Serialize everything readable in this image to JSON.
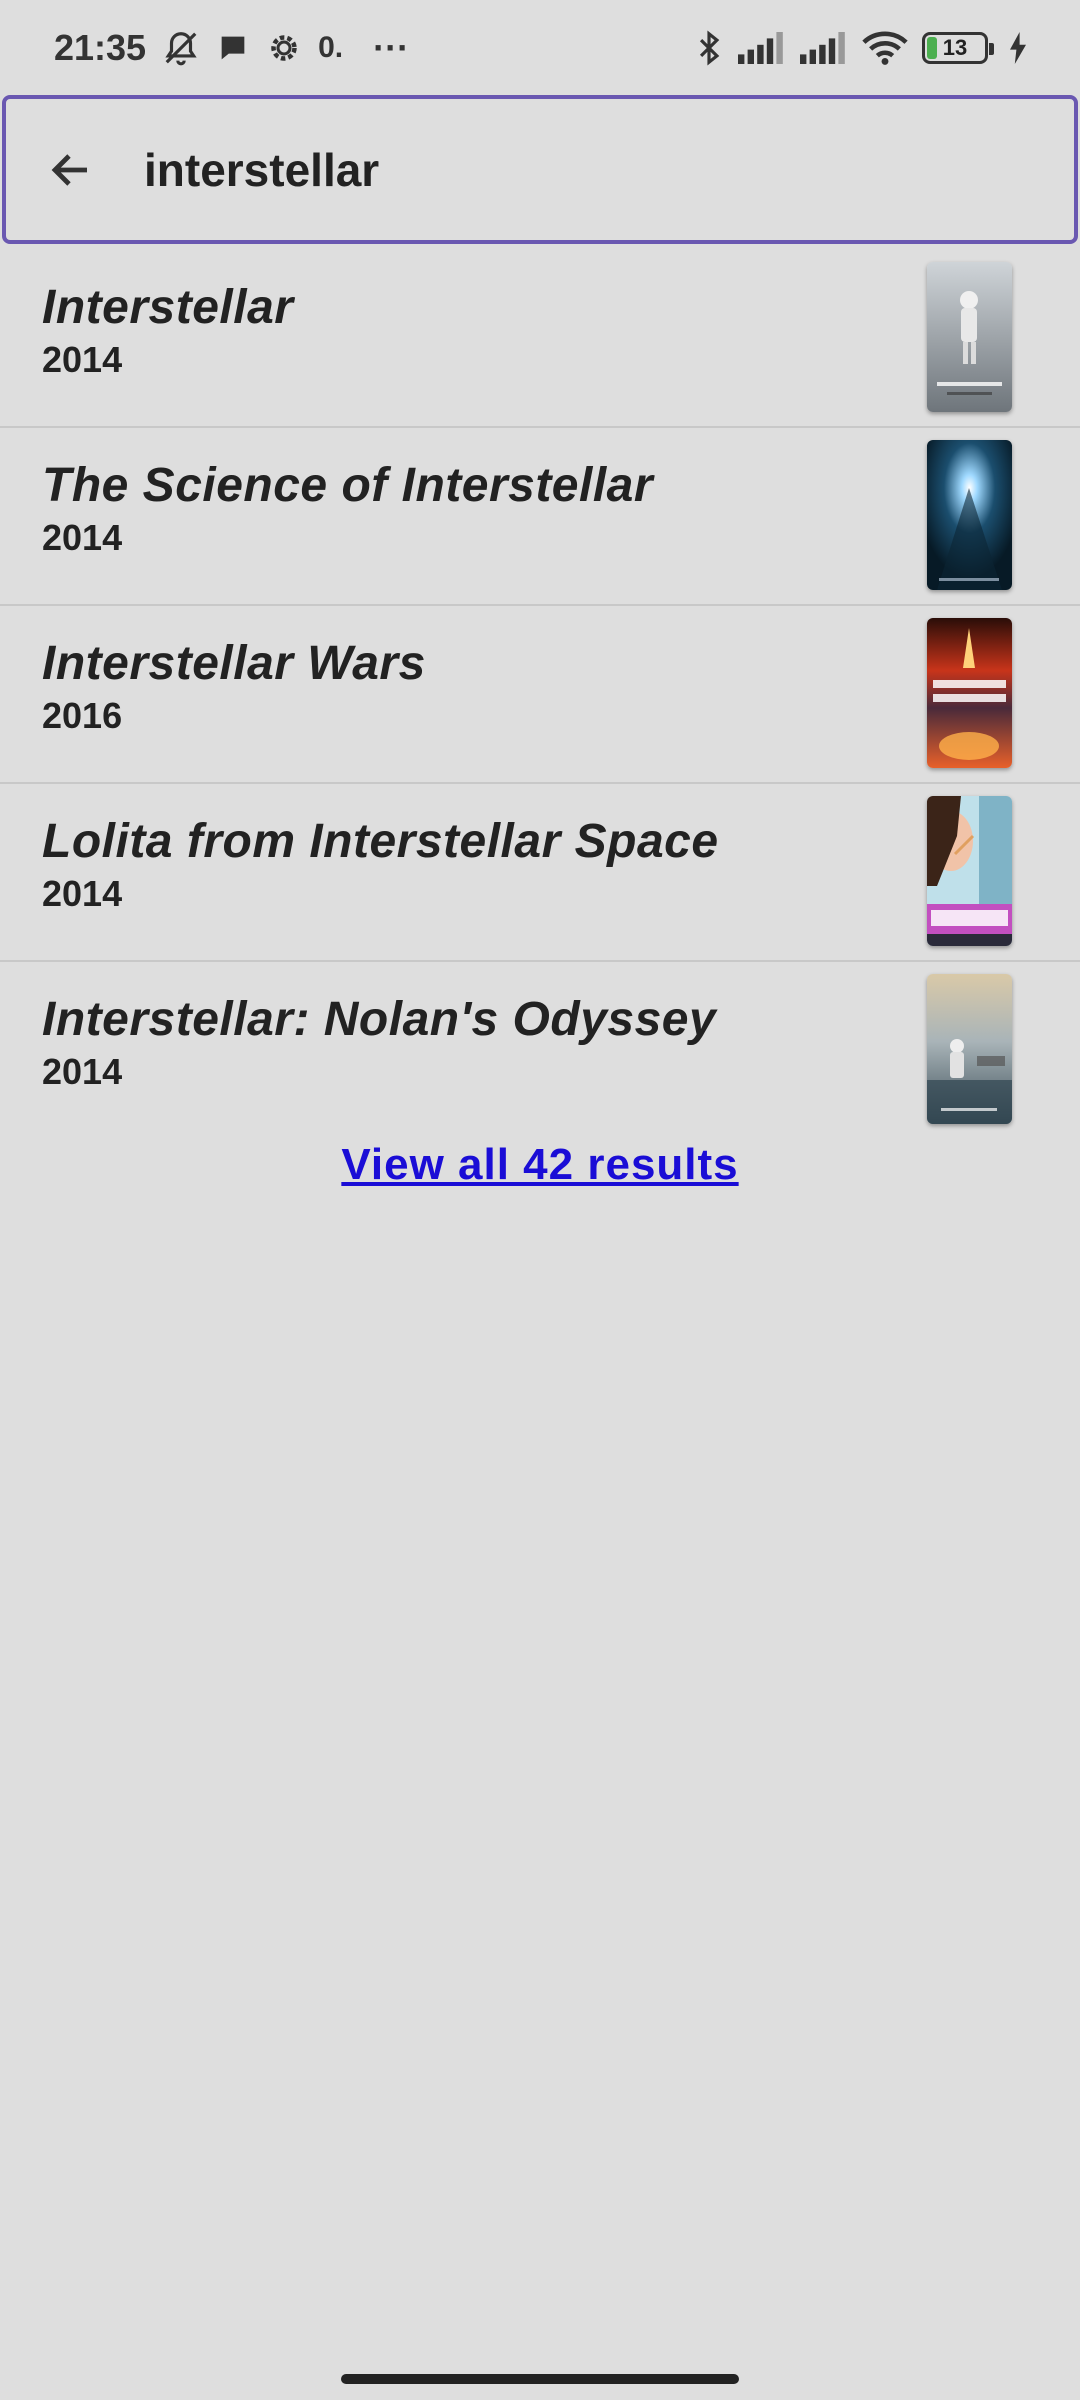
{
  "status_bar": {
    "time": "21:35",
    "extra_indicator": "0.",
    "more_dots": "···",
    "battery_level": "13",
    "icons": [
      "bell-off-icon",
      "chat-bubble-icon",
      "settings-gear-icon",
      "bluetooth-icon",
      "signal-icon",
      "signal-icon",
      "wifi-icon",
      "battery-icon",
      "charging-bolt-icon"
    ]
  },
  "search": {
    "query": "interstellar",
    "back_icon": "arrow-left-icon"
  },
  "results": [
    {
      "title": "Interstellar",
      "year": "2014",
      "poster": "astronaut-poster"
    },
    {
      "title": "The Science of Interstellar",
      "year": "2014",
      "poster": "blue-star-poster"
    },
    {
      "title": "Interstellar Wars",
      "year": "2016",
      "poster": "fiery-explosion-poster"
    },
    {
      "title": "Lolita from Interstellar Space",
      "year": "2014",
      "poster": "woman-lolita-poster"
    },
    {
      "title": "Interstellar: Nolan's Odyssey",
      "year": "2014",
      "poster": "astronaut-water-poster"
    }
  ],
  "view_all": "View all 42 results",
  "colors": {
    "background": "#dedede",
    "search_border": "#6a58b1",
    "link": "#1a0dd6",
    "battery_fill": "#4caf50"
  }
}
